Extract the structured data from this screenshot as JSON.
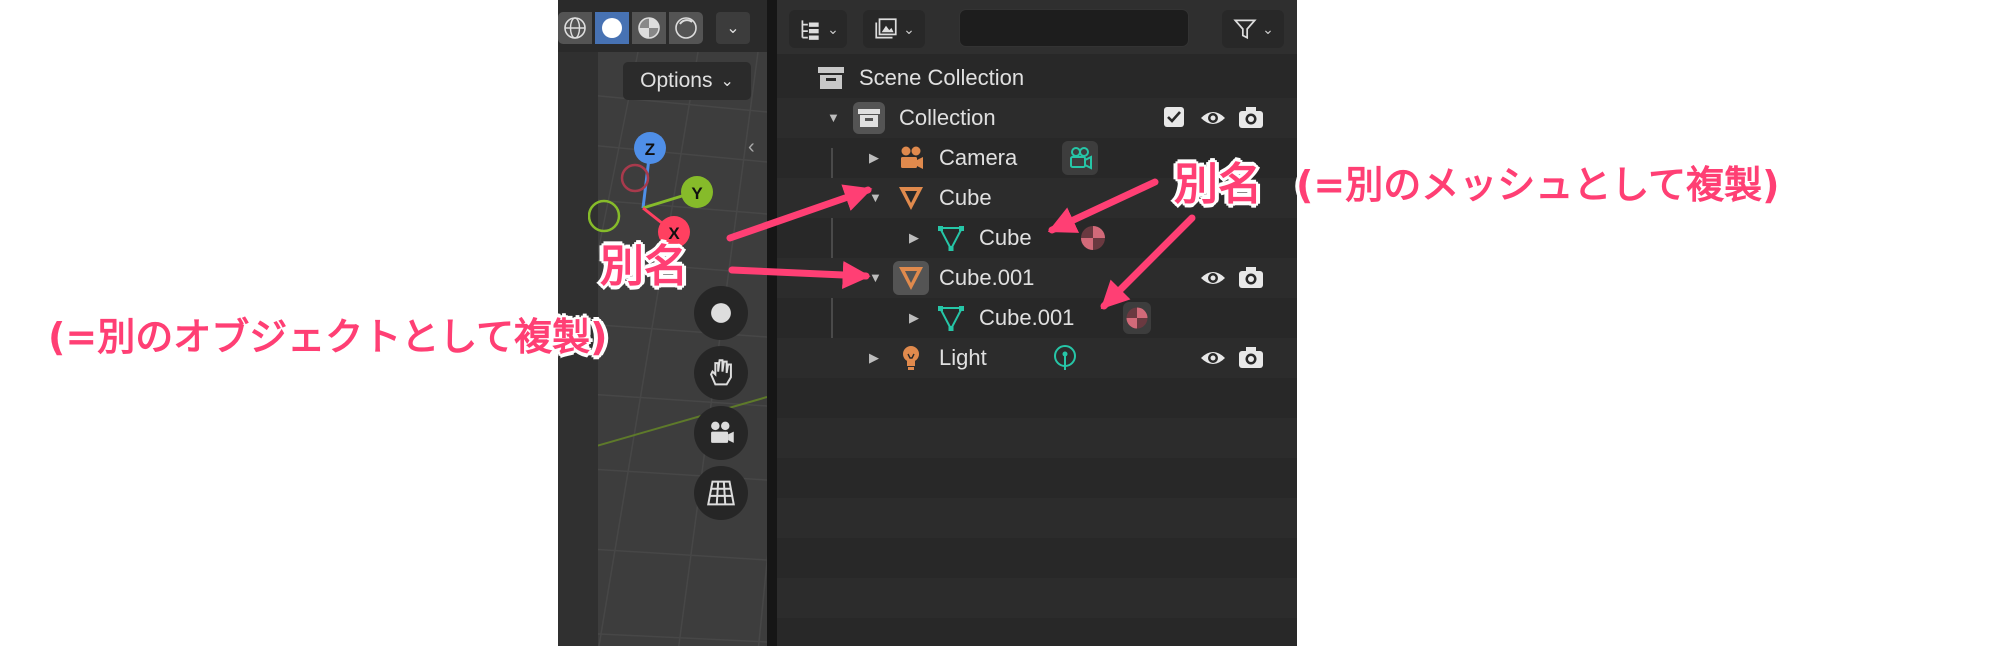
{
  "viewport": {
    "options_label": "Options",
    "dropdown_glyph": "⌄",
    "gizmo": {
      "z": "Z",
      "y": "Y",
      "x": "X"
    },
    "shading_modes": [
      "wireframe",
      "solid",
      "material-preview",
      "rendered"
    ],
    "active_shading": "solid",
    "nav_tools": [
      "move-view",
      "pan-hand",
      "camera-view",
      "toggle-perspective"
    ]
  },
  "outliner": {
    "search": {
      "value": "",
      "placeholder": ""
    },
    "rows": [
      {
        "label": "Scene Collection",
        "type": "scene-collection"
      },
      {
        "label": "Collection",
        "type": "collection",
        "expanded": true,
        "checked": true
      },
      {
        "label": "Camera",
        "type": "object",
        "data_icon": "camera-data-icon"
      },
      {
        "label": "Cube",
        "type": "object",
        "expanded": true
      },
      {
        "label": "Cube",
        "type": "mesh"
      },
      {
        "label": "Cube.001",
        "type": "object",
        "expanded": true
      },
      {
        "label": "Cube.001",
        "type": "mesh"
      },
      {
        "label": "Light",
        "type": "object",
        "data_icon": "light-data-icon"
      }
    ],
    "icon_colors": {
      "object": "#e08a4d",
      "mesh": "#26c6a7",
      "gray": "#bdbdbd"
    }
  },
  "annotations": {
    "left_name": "別名",
    "left_note": "(=別のオブジェクトとして複製)",
    "right_name": "別名",
    "right_note": "(=別のメッシュとして複製)",
    "color": "#ff3f74"
  }
}
